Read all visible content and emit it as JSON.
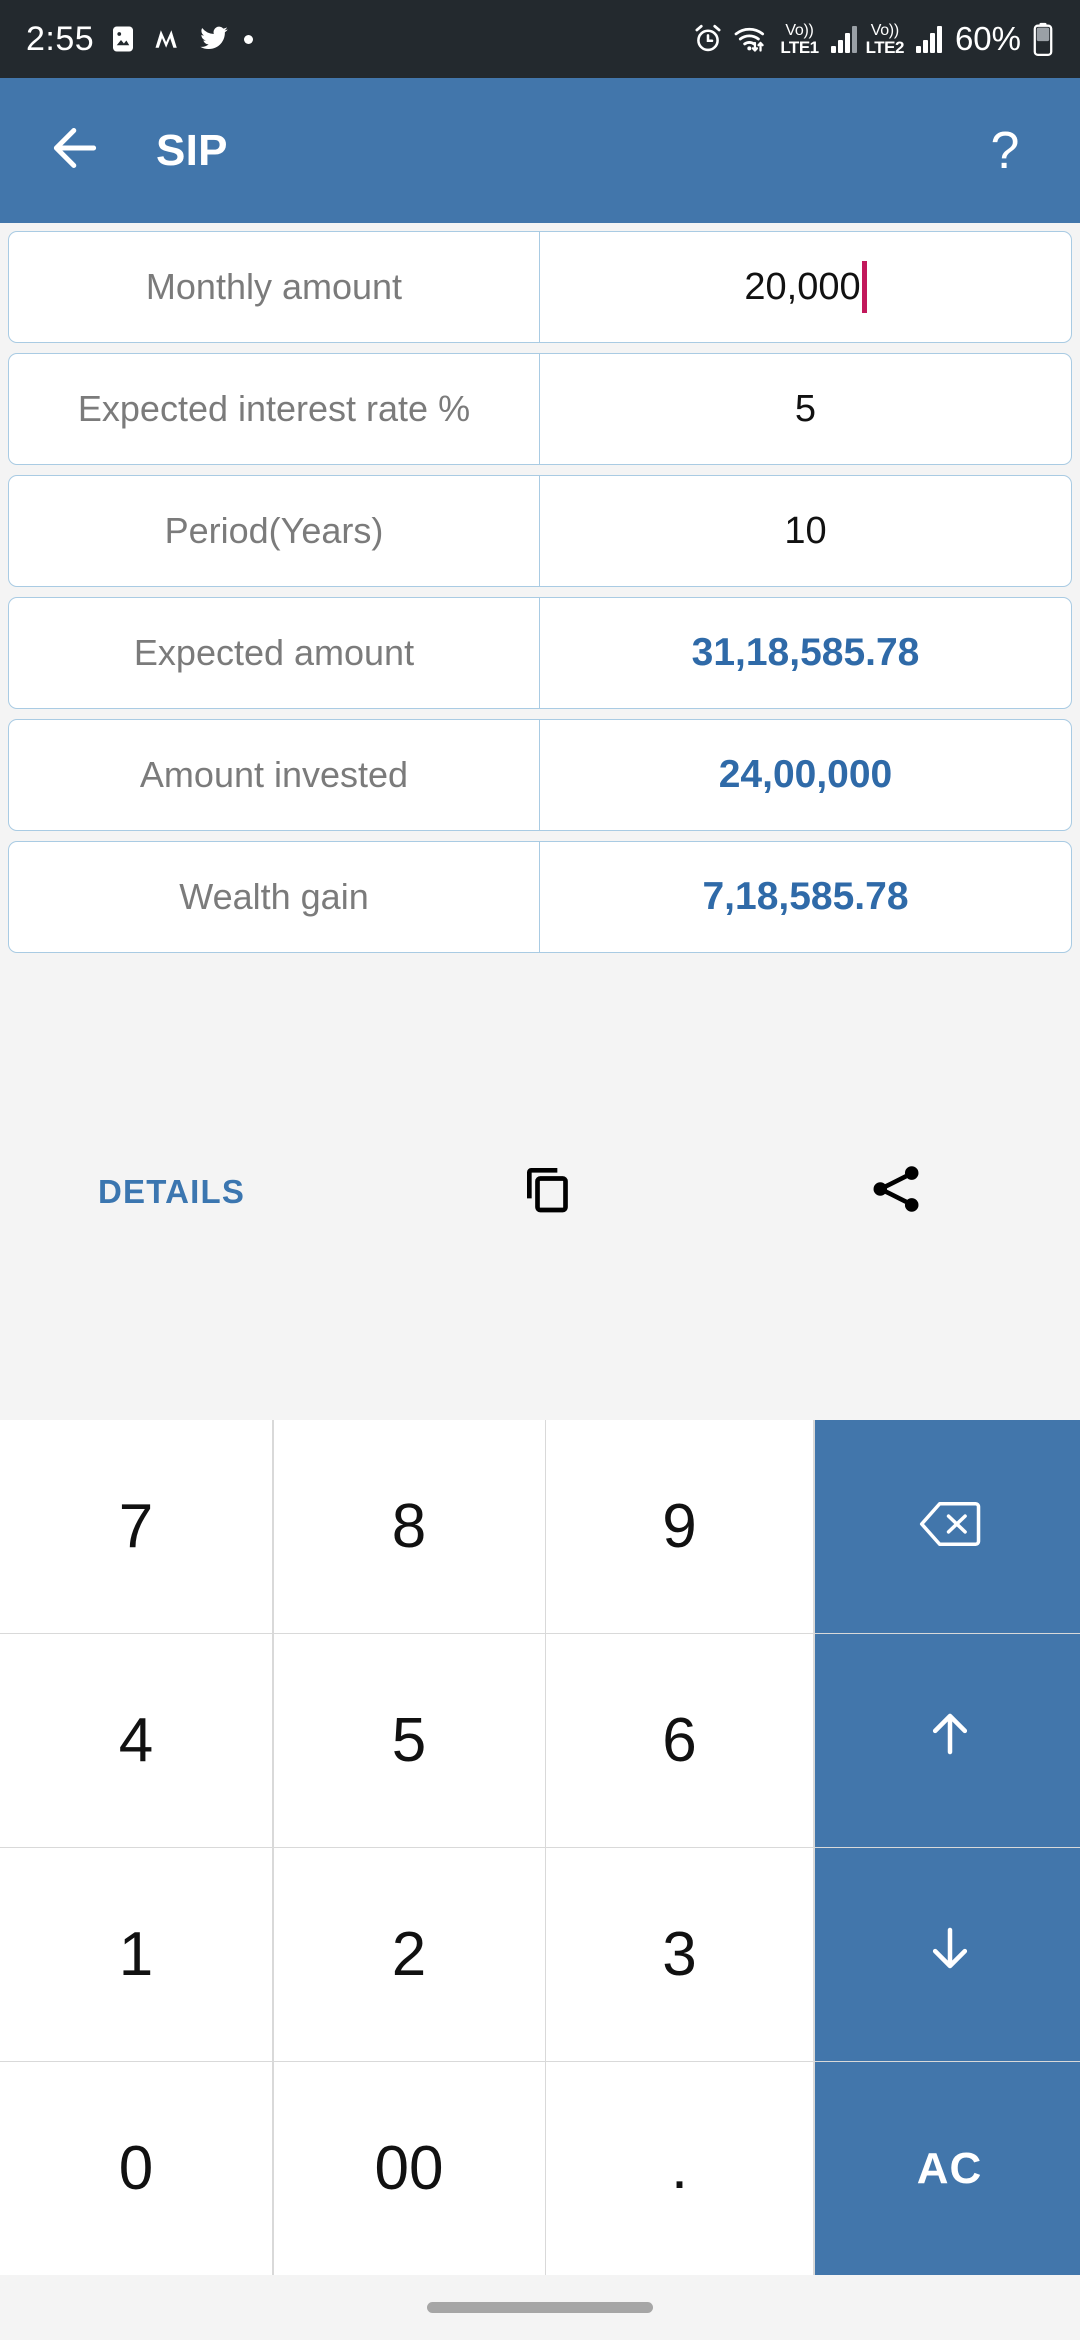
{
  "status_bar": {
    "time": "2:55",
    "left_icons": [
      "photos-icon",
      "medium-icon",
      "twitter-icon",
      "notification-dot-icon"
    ],
    "alarm_icon": "alarm-clock-icon",
    "wifi_icon": "wifi-transfer-icon",
    "sim1": {
      "volte_label": "Vo))",
      "network_label": "LTE1"
    },
    "sim2": {
      "volte_label": "Vo))",
      "network_label": "LTE2"
    },
    "battery_percent": "60%",
    "battery_icon": "battery-icon"
  },
  "app_bar": {
    "back_icon": "back-arrow-icon",
    "title": "SIP",
    "help_label": "?",
    "background_color": "#4276ab"
  },
  "rows": [
    {
      "label": "Monthly amount",
      "value": "20,000",
      "kind": "input",
      "focused": true
    },
    {
      "label": "Expected interest rate %",
      "value": "5",
      "kind": "input",
      "focused": false
    },
    {
      "label": "Period(Years)",
      "value": "10",
      "kind": "input",
      "focused": false
    },
    {
      "label": "Expected amount",
      "value": "31,18,585.78",
      "kind": "result",
      "focused": false
    },
    {
      "label": "Amount invested",
      "value": "24,00,000",
      "kind": "result",
      "focused": false
    },
    {
      "label": "Wealth gain",
      "value": "7,18,585.78",
      "kind": "result",
      "focused": false
    }
  ],
  "actions": {
    "details_label": "DETAILS",
    "copy_icon": "copy-icon",
    "share_icon": "share-icon",
    "details_color": "#3b76b0"
  },
  "keypad": {
    "keys": [
      {
        "label": "7",
        "type": "digit"
      },
      {
        "label": "8",
        "type": "digit"
      },
      {
        "label": "9",
        "type": "digit"
      },
      {
        "label": "",
        "type": "fn",
        "icon": "backspace-icon"
      },
      {
        "label": "4",
        "type": "digit"
      },
      {
        "label": "5",
        "type": "digit"
      },
      {
        "label": "6",
        "type": "digit"
      },
      {
        "label": "",
        "type": "fn",
        "icon": "arrow-up-icon"
      },
      {
        "label": "1",
        "type": "digit"
      },
      {
        "label": "2",
        "type": "digit"
      },
      {
        "label": "3",
        "type": "digit"
      },
      {
        "label": "",
        "type": "fn",
        "icon": "arrow-down-icon"
      },
      {
        "label": "0",
        "type": "digit"
      },
      {
        "label": "00",
        "type": "digit"
      },
      {
        "label": ".",
        "type": "digit"
      },
      {
        "label": "AC",
        "type": "fn",
        "icon": ""
      }
    ],
    "fn_color": "#4276ab"
  },
  "nav_bar": {
    "pill_icon": "home-gesture-pill"
  },
  "colors": {
    "accent_blue": "#4276ab",
    "value_blue": "#2f6aa8",
    "card_border": "#a9cbe3",
    "label_gray": "#7b7b7b",
    "caret_pink": "#c2185b",
    "status_bg": "#23292e"
  }
}
